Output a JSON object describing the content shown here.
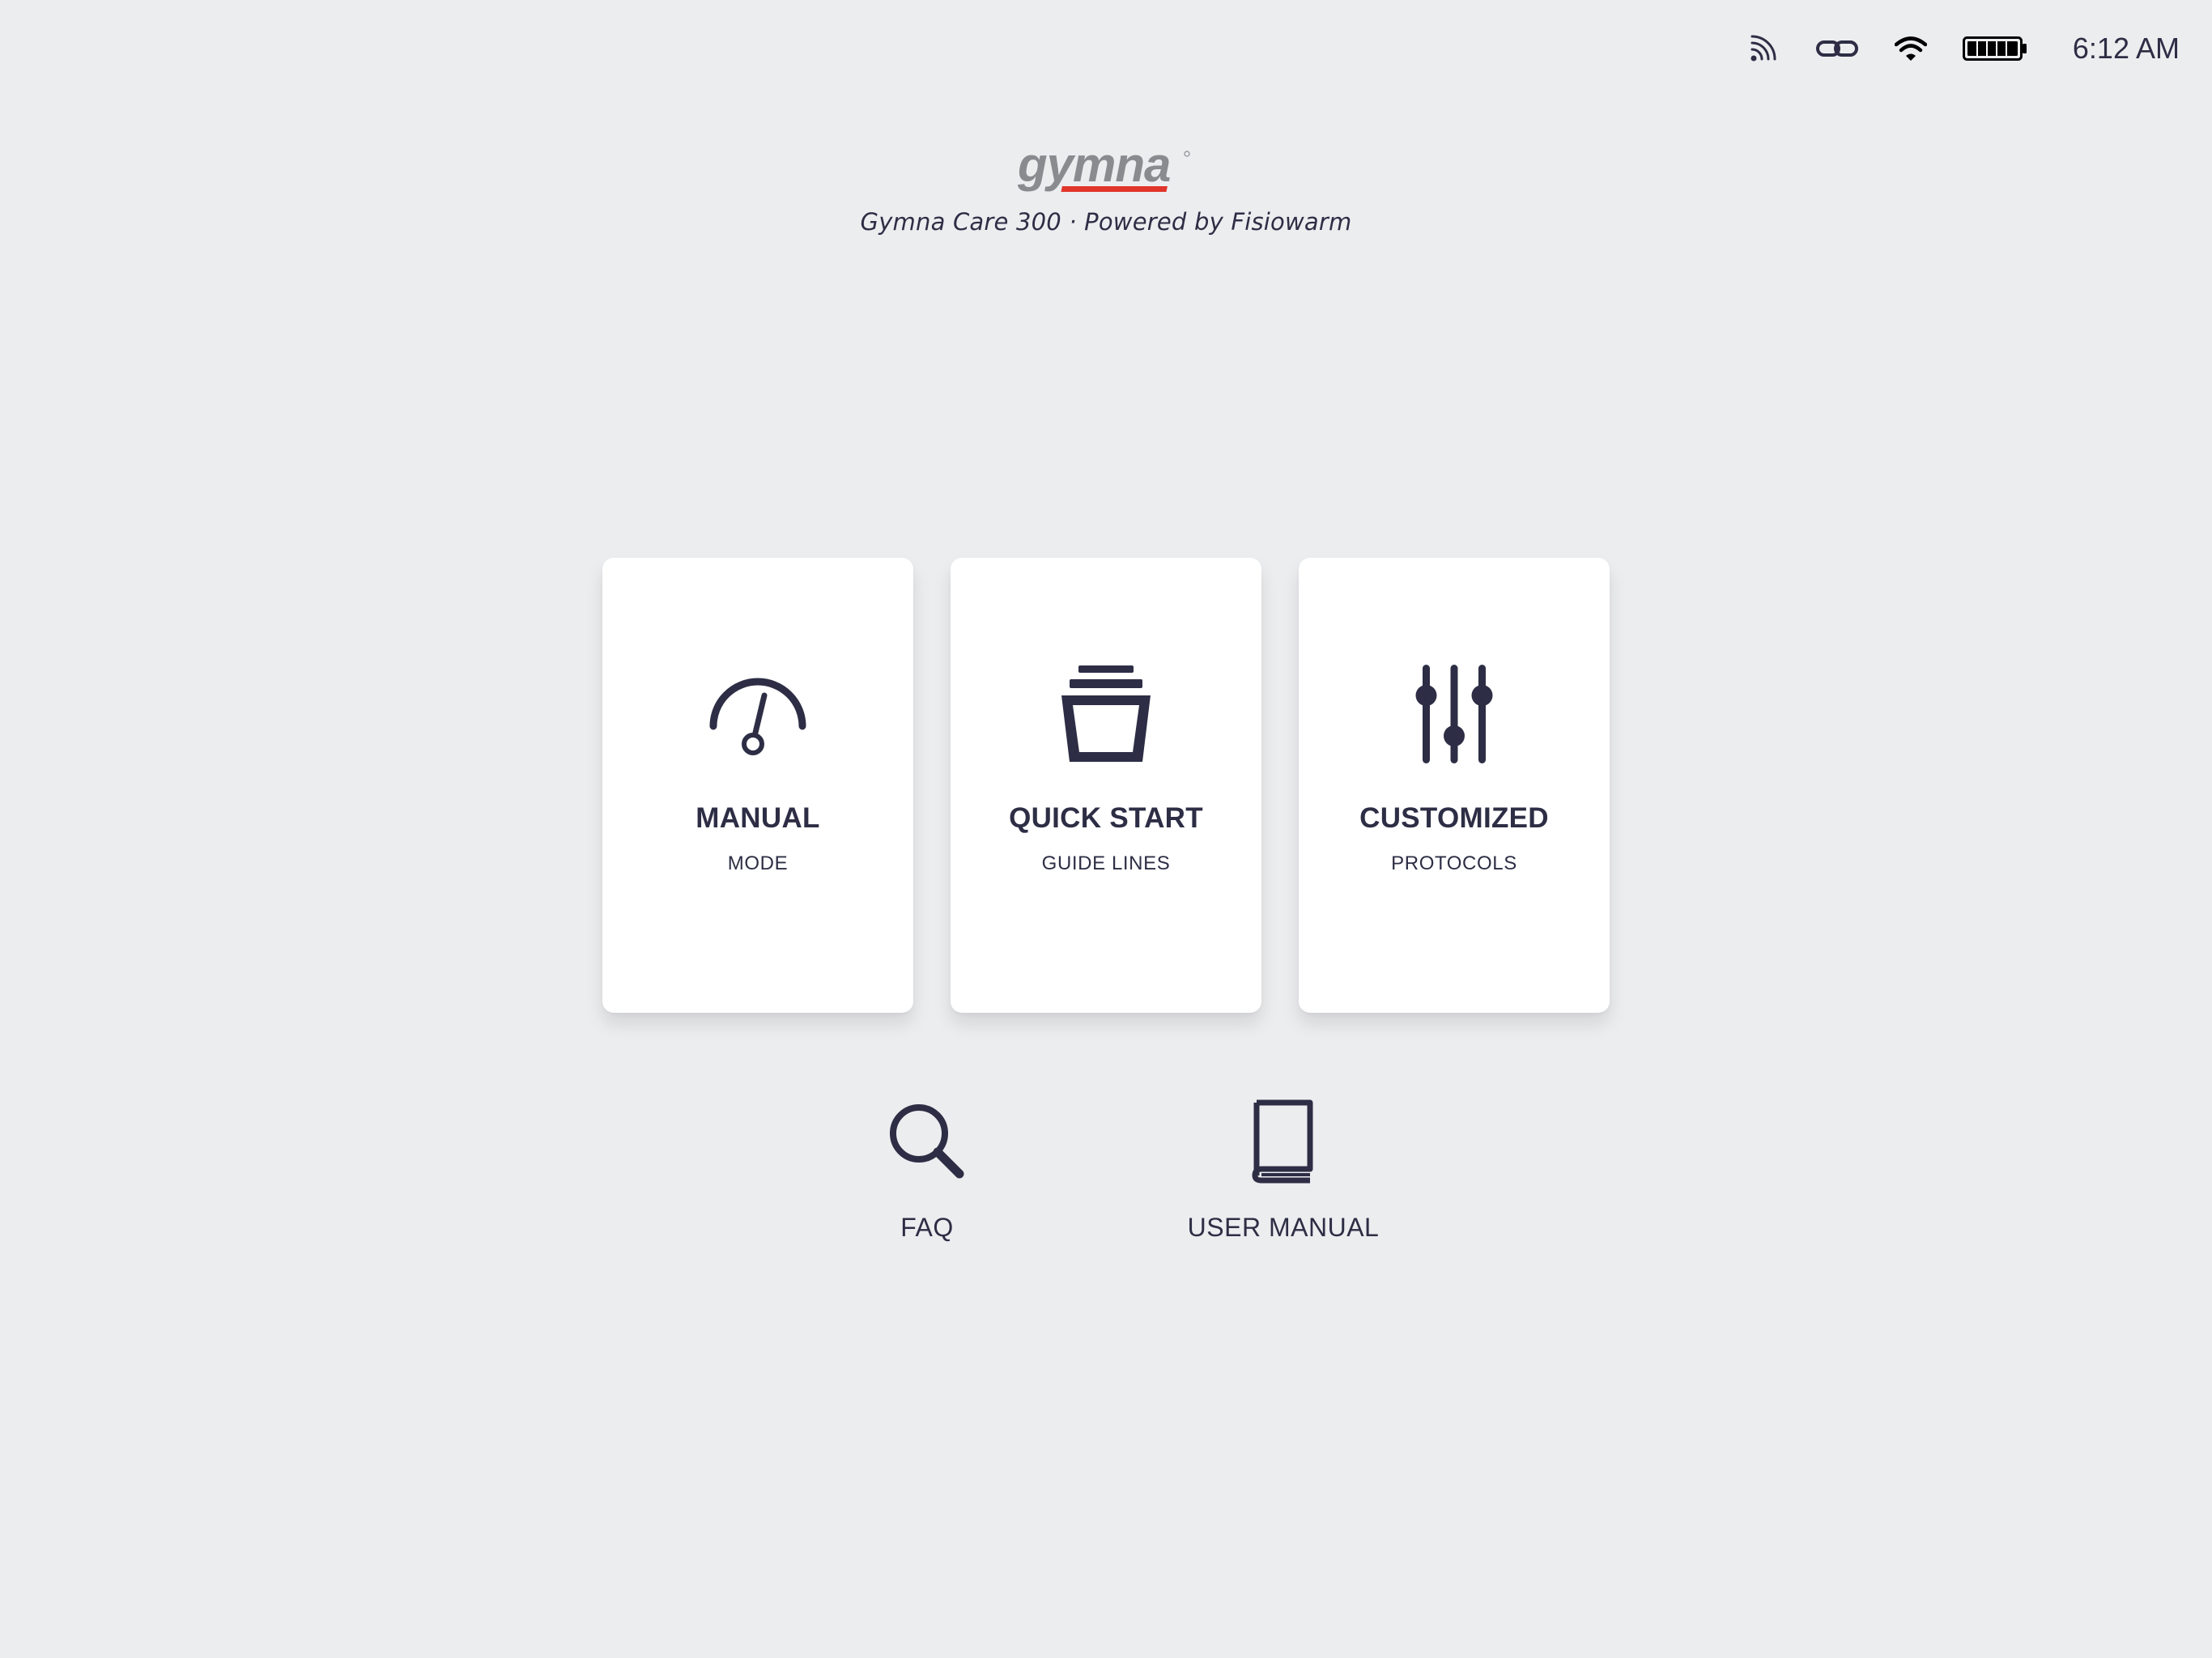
{
  "status_bar": {
    "icons": [
      "signal-icon",
      "link-icon",
      "wifi-icon",
      "battery-icon"
    ],
    "time": "6:12 AM"
  },
  "brand": {
    "logo_text": "gymna",
    "tagline": "Gymna Care 300 · Powered by Fisiowarm",
    "accent_color": "#e0352b",
    "logo_color": "#8a8b8f"
  },
  "cards": [
    {
      "icon": "gauge-icon",
      "title": "MANUAL",
      "subtitle": "MODE"
    },
    {
      "icon": "stack-icon",
      "title": "QUICK START",
      "subtitle": "GUIDE LINES"
    },
    {
      "icon": "sliders-icon",
      "title": "CUSTOMIZED",
      "subtitle": "PROTOCOLS"
    }
  ],
  "links": {
    "faq": {
      "icon": "search-icon",
      "label": "FAQ"
    },
    "user_manual": {
      "icon": "book-icon",
      "label": "USER MANUAL"
    }
  },
  "colors": {
    "background": "#ecedef",
    "text": "#2d2e45",
    "card": "#ffffff"
  }
}
